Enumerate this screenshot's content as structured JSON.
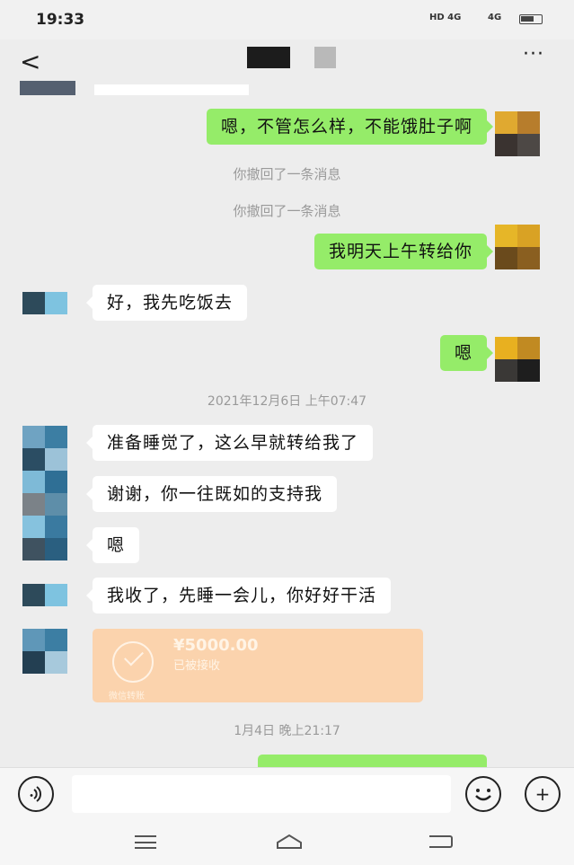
{
  "status_bar": {
    "time": "19:33",
    "signal1": "HD 4G",
    "signal2": "4G"
  },
  "top_bar": {
    "back_icon": "chevron-left-icon",
    "more_icon": "ellipsis-icon",
    "more_label": "···"
  },
  "messages": [
    {
      "side": "me",
      "text": "嗯，不管怎么样，不能饿肚子啊"
    },
    {
      "type": "system",
      "text": "你撤回了一条消息"
    },
    {
      "type": "system",
      "text": "你撤回了一条消息"
    },
    {
      "side": "me",
      "text": "我明天上午转给你"
    },
    {
      "side": "other",
      "text": "好，我先吃饭去"
    },
    {
      "side": "me",
      "text": "嗯"
    },
    {
      "type": "timestamp",
      "text": "2021年12月6日 上午07:47"
    },
    {
      "side": "other",
      "text": "准备睡觉了，这么早就转给我了"
    },
    {
      "side": "other",
      "text": "谢谢，你一往既如的支持我"
    },
    {
      "side": "other",
      "text": "嗯"
    },
    {
      "side": "other",
      "text": "我收了，先睡一会儿，你好好干活"
    },
    {
      "type": "transfer",
      "amount": "¥5000.00",
      "status": "已被接收",
      "footer": "微信转账"
    },
    {
      "type": "timestamp",
      "text": "1月4日 晚上21:17"
    }
  ],
  "input_bar": {
    "voice_icon": "voice-icon",
    "emoji_icon": "emoji-icon",
    "plus_icon": "plus-icon",
    "plus_label": "+"
  },
  "nav_bar": {
    "menu_icon": "menu-icon",
    "home_icon": "home-icon",
    "back_icon": "back-icon"
  }
}
